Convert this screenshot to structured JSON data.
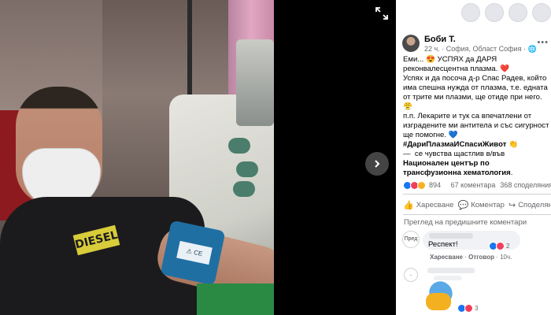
{
  "post": {
    "author": "Боби Т.",
    "meta": "22 ч. · София, Област София · ",
    "lines": [
      "Еми... 😍 УСПЯХ да ДАРЯ реконвалесцентна плазма. ❤️",
      "Успях и да посоча д-р Спас Радев, който има спешна нужда от плазма, т.е. едната от трите ми плазми, ще отиде при него. 😤",
      "п.п. Лекарите и тук са впечатлени от изградените ми антитела и със сигурност ще помогне. 💙"
    ],
    "hashtag": "#ДариПлазмаИСпасиЖивот 👏",
    "feeling_prefix": "—  се чувства щастлив в/във",
    "feeling_place": "Национален център по трансфузионна хематология",
    "feeling_suffix": "."
  },
  "reactions": {
    "count": "894",
    "comments": "67 коментара",
    "shares": "368 споделяния"
  },
  "actions": {
    "like": "Харесване",
    "comment": "Коментар",
    "share": "Споделяне"
  },
  "comments": {
    "prev_label": "Преглед на предишните коментари",
    "c1_avatar": "Пред",
    "c1_text": "Респект!",
    "c1_react_count": "2",
    "c1_like": "Харесване",
    "c1_reply": "Отговор",
    "c1_time": "10ч.",
    "c2_react_count": "3"
  },
  "viewer": {
    "shirt_logo": "DIESEL",
    "cuff_label": "⚠ CE"
  },
  "icons": {
    "fullscreen": "fullscreen-icon",
    "next": "chevron-right-icon",
    "more": "more-icon",
    "globe": "globe-icon",
    "like": "thumbs-up-icon",
    "comment": "comment-bubble-icon",
    "share": "share-arrow-icon"
  },
  "colors": {
    "like_blue": "#1877f2",
    "love_red": "#f33e58",
    "wow_yellow": "#f7b125",
    "secondary_text": "#65676b"
  }
}
